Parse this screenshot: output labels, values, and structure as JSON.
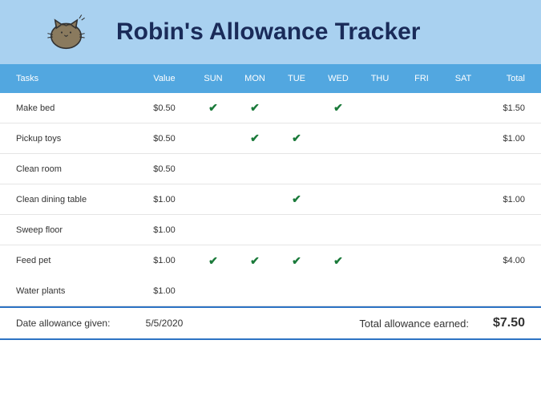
{
  "title": "Robin's Allowance Tracker",
  "columns": {
    "task": "Tasks",
    "value": "Value",
    "days": [
      "SUN",
      "MON",
      "TUE",
      "WED",
      "THU",
      "FRI",
      "SAT"
    ],
    "total": "Total"
  },
  "rows": [
    {
      "task": "Make bed",
      "value": "$0.50",
      "checks": [
        true,
        true,
        false,
        true,
        false,
        false,
        false
      ],
      "total": "$1.50"
    },
    {
      "task": "Pickup toys",
      "value": "$0.50",
      "checks": [
        false,
        true,
        true,
        false,
        false,
        false,
        false
      ],
      "total": "$1.00"
    },
    {
      "task": "Clean room",
      "value": "$0.50",
      "checks": [
        false,
        false,
        false,
        false,
        false,
        false,
        false
      ],
      "total": ""
    },
    {
      "task": "Clean dining table",
      "value": "$1.00",
      "checks": [
        false,
        false,
        true,
        false,
        false,
        false,
        false
      ],
      "total": "$1.00"
    },
    {
      "task": "Sweep floor",
      "value": "$1.00",
      "checks": [
        false,
        false,
        false,
        false,
        false,
        false,
        false
      ],
      "total": ""
    },
    {
      "task": "Feed pet",
      "value": "$1.00",
      "checks": [
        true,
        true,
        true,
        true,
        false,
        false,
        false
      ],
      "total": "$4.00"
    },
    {
      "task": "Water plants",
      "value": "$1.00",
      "checks": [
        false,
        false,
        false,
        false,
        false,
        false,
        false
      ],
      "total": ""
    }
  ],
  "footer": {
    "date_label": "Date allowance given:",
    "date": "5/5/2020",
    "total_label": "Total allowance earned:",
    "total": "$7.50"
  }
}
